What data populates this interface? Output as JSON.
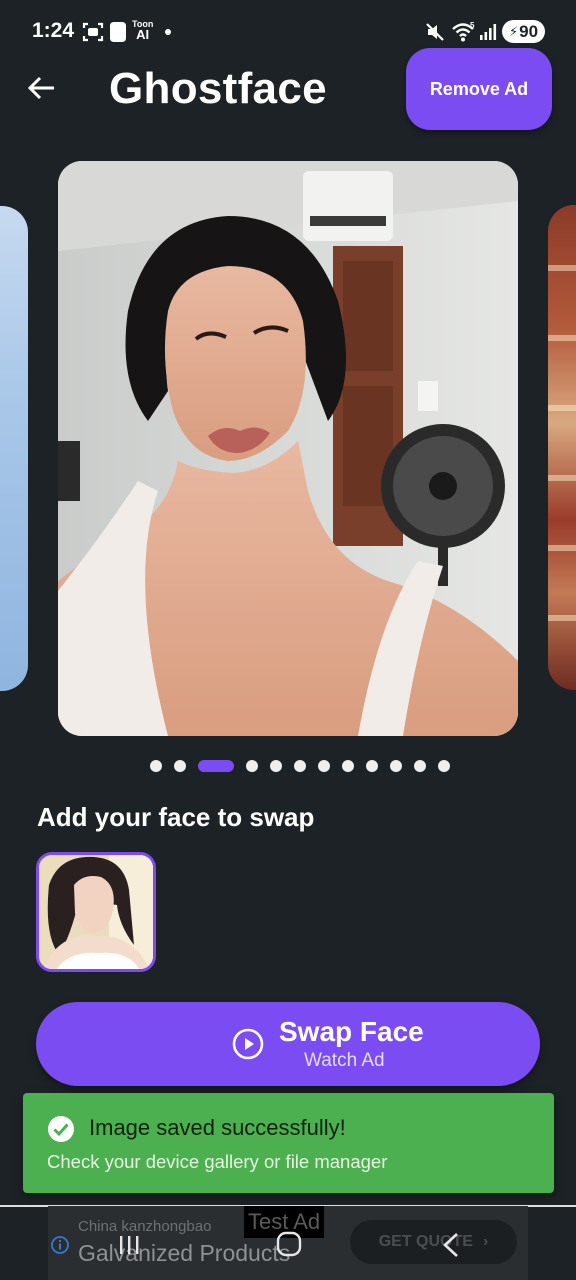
{
  "status_bar": {
    "time": "1:24",
    "toon_line1": "Toon",
    "toon_line2": "AI",
    "battery_level": "90",
    "icons": [
      "screenshot-icon",
      "circle-app-icon",
      "notification-dot",
      "mute-icon",
      "wifi-icon",
      "signal-icon",
      "battery-charging-icon"
    ]
  },
  "app_bar": {
    "title": "Ghostface",
    "remove_ad_label": "Remove Ad",
    "back_icon": "arrow-left-icon"
  },
  "carousel": {
    "total_dots": 12,
    "active_index": 2
  },
  "face_section": {
    "heading": "Add your face to swap"
  },
  "swap_button": {
    "label": "Swap Face",
    "sublabel": "Watch Ad",
    "icon": "play-circle-icon"
  },
  "toast": {
    "title": "Image saved successfully!",
    "message": "Check your device gallery or file manager",
    "icon": "check-circle-icon"
  },
  "ad": {
    "advertiser": "China kanzhongbao",
    "headline": "Galvanized Products",
    "test_label": "Test Ad",
    "cta_label": "GET QUOTE",
    "cta_icon": "chevron-right-icon"
  },
  "colors": {
    "background": "#1c2226",
    "accent": "#7b4cf2",
    "toast_green": "#4caf50"
  },
  "nav_bar": {
    "icons": [
      "recent-apps-icon",
      "home-icon",
      "back-icon"
    ]
  }
}
